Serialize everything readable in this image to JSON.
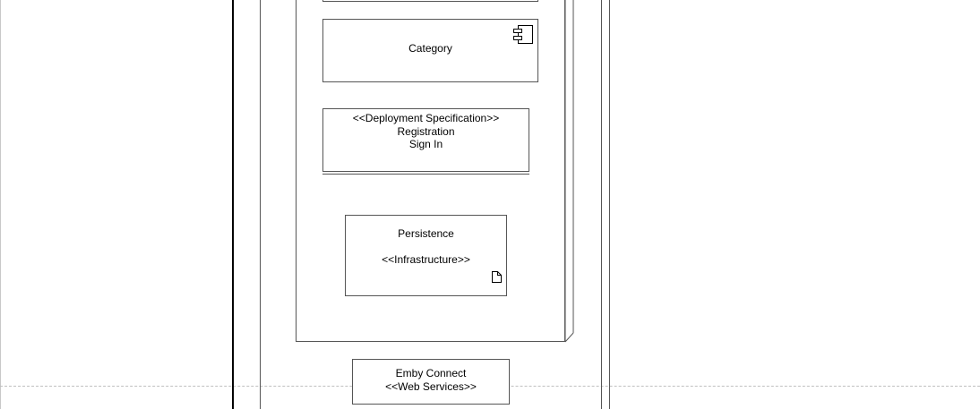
{
  "diagram": {
    "category": {
      "label": "Category",
      "icon": "component-icon"
    },
    "deployment_spec": {
      "stereotype": "<<Deployment Specification>>",
      "lines": [
        "Registration",
        "Sign In"
      ]
    },
    "persistence": {
      "name": "Persistence",
      "stereotype": "<<Infrastructure>>",
      "icon": "document-icon"
    },
    "emby_connect": {
      "name": "Emby Connect",
      "stereotype": "<<Web Services>>"
    }
  }
}
